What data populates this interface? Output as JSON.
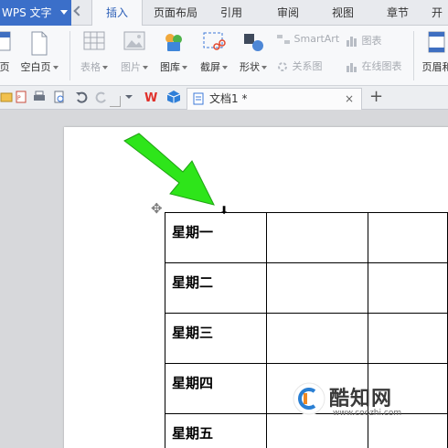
{
  "app": {
    "title": "WPS 文字"
  },
  "menu": {
    "tabs": [
      {
        "label": "插入",
        "active": true
      },
      {
        "label": "页面布局"
      },
      {
        "label": "引用"
      },
      {
        "label": "审阅"
      },
      {
        "label": "视图"
      },
      {
        "label": "章节"
      },
      {
        "label": "开"
      }
    ]
  },
  "ribbon": {
    "left_partial_label": "页",
    "blank_page": "空白页",
    "table": "表格",
    "image": "图片",
    "gallery": "图库",
    "screenshot": "截屏",
    "shapes": "形状",
    "smartart": "SmartArt",
    "chart": "图表",
    "relationship": "关系图",
    "online_chart": "在线图表",
    "header_footer": "页眉和"
  },
  "document": {
    "tab_title": "文档1 *",
    "close_symbol": "×",
    "new_tab_symbol": "+",
    "table_rows": [
      "星期一",
      "星期二",
      "星期三",
      "星期四",
      "星期五"
    ]
  },
  "watermark": {
    "title": "酷知网",
    "url": "www.coozhi.com"
  },
  "colors": {
    "app_button": "#3b6fc9",
    "active_tab_text": "#2c5fb7",
    "arrow": "#2ee51a"
  }
}
